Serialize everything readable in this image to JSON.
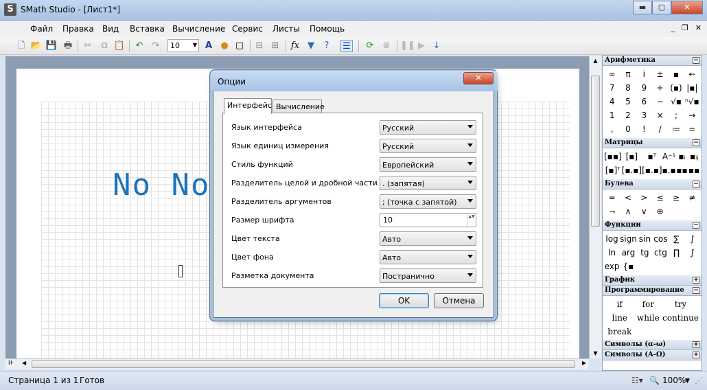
{
  "window": {
    "title": "SMath Studio - [Лист1*]",
    "icon_letter": "S",
    "minimize": "▬",
    "maximize": "▢",
    "close": "✕"
  },
  "menu": [
    "Файл",
    "Правка",
    "Вид",
    "Вставка",
    "Вычисление",
    "Сервис",
    "Листы",
    "Помощь"
  ],
  "mdi": {
    "minimize": "_",
    "restore": "❐",
    "close": "✕"
  },
  "toolbar": {
    "font_size": "10"
  },
  "document": {
    "text": "No Note"
  },
  "status": {
    "page": "Страница 1 из 1",
    "state": "Готов",
    "zoom": "100%"
  },
  "dialog": {
    "title": "Опции",
    "tabs": [
      "Интерфейс",
      "Вычисление"
    ],
    "options": [
      {
        "label": "Язык интерфейса",
        "value": "Русский",
        "kind": "combo"
      },
      {
        "label": "Язык единиц измерения",
        "value": "Русский",
        "kind": "combo"
      },
      {
        "label": "Стиль функций",
        "value": "Европейский",
        "kind": "combo"
      },
      {
        "label": "Разделитель целой и дробной части",
        "value": ". (запятая)",
        "kind": "combo"
      },
      {
        "label": "Разделитель аргументов",
        "value": "; (точка с запятой)",
        "kind": "combo"
      },
      {
        "label": "Размер шрифта",
        "value": "10",
        "kind": "spin"
      },
      {
        "label": "Цвет текста",
        "value": "Авто",
        "kind": "combo"
      },
      {
        "label": "Цвет фона",
        "value": "Авто",
        "kind": "combo"
      },
      {
        "label": "Разметка документа",
        "value": "Постранично",
        "kind": "combo"
      }
    ],
    "ok": "OK",
    "cancel": "Отмена"
  },
  "panel": {
    "arithmetic": {
      "title": "Арифметика",
      "symbols": [
        "∞",
        "π",
        "i",
        "±",
        "▪",
        "←",
        "7",
        "8",
        "9",
        "+",
        "(▪)",
        "|▪|",
        "4",
        "5",
        "6",
        "−",
        "√▪",
        "ⁿ√▪",
        "1",
        "2",
        "3",
        "×",
        ";",
        "→",
        ",",
        "0",
        "!",
        "/",
        "≔",
        "="
      ]
    },
    "matrices": {
      "title": "Матрицы",
      "symbols": [
        "[▪▪]",
        "[▪]",
        "▪ᵀ",
        "A⁻¹",
        "▪ᵢ",
        "▪ᵢⱼ",
        "[▪]ᵀ",
        "[▪.▪]",
        "[▪.▪]",
        "▪.▪",
        "▪▪",
        "▪▪"
      ]
    },
    "boolean": {
      "title": "Булева",
      "symbols": [
        "=",
        "<",
        ">",
        "≤",
        "≥",
        "≠",
        "¬",
        "∧",
        "∨",
        "⊕"
      ]
    },
    "functions": {
      "title": "Функции",
      "symbols": [
        "log",
        "sign",
        "sin",
        "cos",
        "∑",
        "∫",
        "ln",
        "arg",
        "tg",
        "ctg",
        "∏",
        "∫",
        "exp",
        "{▪"
      ]
    },
    "graph": {
      "title": "График"
    },
    "programming": {
      "title": "Программирование",
      "symbols": [
        "if",
        "for",
        "try",
        "line",
        "while",
        "continue",
        "break"
      ]
    },
    "symbols_lower": {
      "title": "Символы (α-ω)"
    },
    "symbols_upper": {
      "title": "Символы (Α-Ω)"
    }
  }
}
